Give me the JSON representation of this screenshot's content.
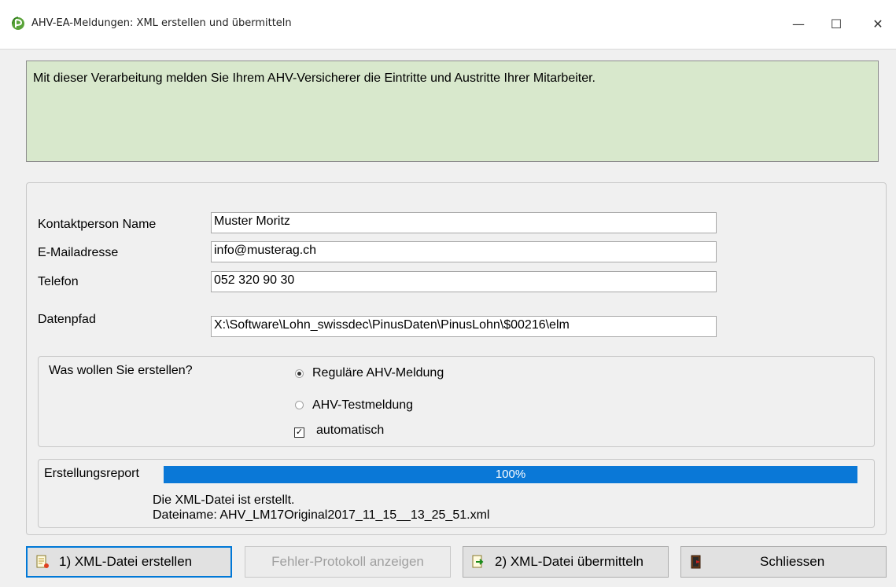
{
  "window": {
    "title": "AHV-EA-Meldungen: XML erstellen und übermitteln",
    "minimize_glyph": "—",
    "maximize_glyph": "☐",
    "close_glyph": "✕"
  },
  "info": {
    "text": "Mit dieser Verarbeitung melden Sie Ihrem AHV-Versicherer die Eintritte und Austritte Ihrer Mitarbeiter."
  },
  "form": {
    "contact_label": "Kontaktperson Name",
    "contact_value": "Muster Moritz",
    "email_label": "E-Mailadresse",
    "email_value": "info@musterag.ch",
    "phone_label": "Telefon",
    "phone_value": "052 320 90 30",
    "path_label": "Datenpfad",
    "path_value": "X:\\Software\\Lohn_swissdec\\PinusDaten\\PinusLohn\\$00216\\elm"
  },
  "options": {
    "question": "Was wollen Sie erstellen?",
    "regular_label": "Reguläre AHV-Meldung",
    "regular_checked": true,
    "test_label": "AHV-Testmeldung",
    "test_checked": false,
    "auto_label": "automatisch",
    "auto_checked": true,
    "check_glyph": "✓"
  },
  "report": {
    "label": "Erstellungsreport",
    "progress_text": "100%",
    "progress_value": 1.0,
    "message_line1": "Die XML-Datei ist erstellt.",
    "message_line2": "Dateiname: AHV_LM17Original2017_11_15__13_25_51.xml"
  },
  "buttons": {
    "create_label": "1) XML-Datei erstellen",
    "error_log_label": "Fehler-Protokoll anzeigen",
    "transmit_label": "2) XML-Datei übermitteln",
    "close_label": "Schliessen"
  },
  "icons": {
    "app": "app-logo-icon",
    "create": "document-create-icon",
    "transmit": "document-send-icon",
    "close": "exit-door-icon"
  }
}
